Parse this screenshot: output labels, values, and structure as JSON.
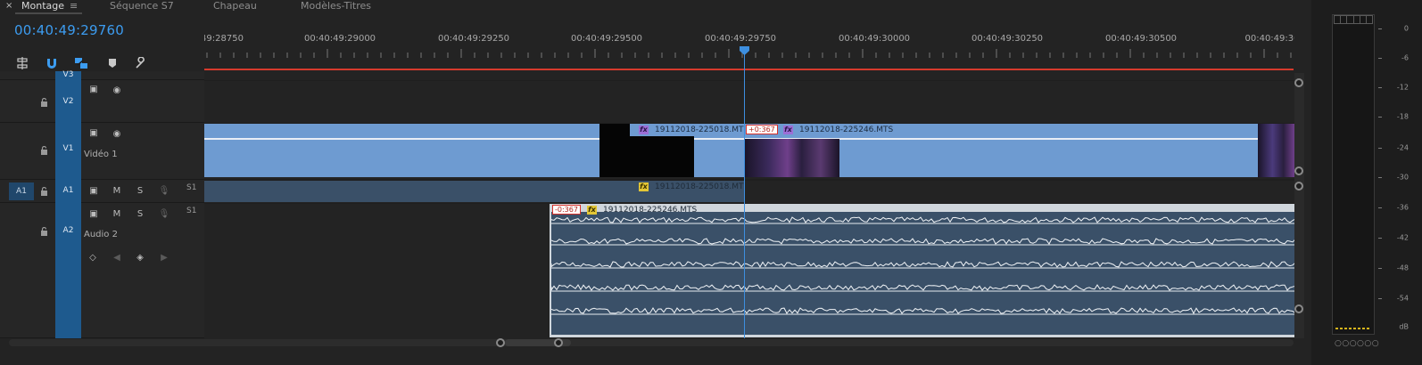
{
  "tabs": {
    "close_glyph": "×",
    "menu_glyph": "≡",
    "items": [
      {
        "label": "Montage",
        "active": true
      },
      {
        "label": "Séquence S7",
        "active": false
      },
      {
        "label": "Chapeau",
        "active": false
      },
      {
        "label": "Modèles-Titres",
        "active": false
      }
    ]
  },
  "timecode": "00:40:49:29760",
  "toolbar": [
    "insert-nest-icon",
    "snap-magnet-icon",
    "linked-selection-icon",
    "add-marker-icon",
    "settings-wrench-icon"
  ],
  "ruler": {
    "labels": [
      "49:28750",
      "00:40:49:29000",
      "00:40:49:29250",
      "00:40:49:29500",
      "00:40:49:29750",
      "00:40:49:30000",
      "00:40:49:30250",
      "00:40:49:30500",
      "00:40:49:30"
    ]
  },
  "tracks": {
    "v3": {
      "target": "V3"
    },
    "v2": {
      "target": "V2"
    },
    "v1": {
      "target": "V1",
      "name": "Vidéo 1"
    },
    "a1": {
      "source": "A1",
      "target": "A1",
      "mute": "M",
      "solo": "S",
      "sync": "S1"
    },
    "a2": {
      "target": "A2",
      "name": "Audio 2",
      "mute": "M",
      "solo": "S",
      "sync": "S1"
    }
  },
  "clips": {
    "v1_a": {
      "name": "19112018-225018.MTS [V]",
      "fx": "fx"
    },
    "v1_b": {
      "name": "19112018-225246.MTS",
      "fx": "fx",
      "offset": "+0:367"
    },
    "a1_a": {
      "name": "19112018-225018.MTS [A]",
      "fx": "fx"
    },
    "a2_b": {
      "name": "19112018-225246.MTS",
      "fx": "fx",
      "offset": "-0:367"
    }
  },
  "meter": {
    "db_labels": [
      "0",
      "-6",
      "-12",
      "-18",
      "-24",
      "-30",
      "-36",
      "-42",
      "-48",
      "-54",
      "dB"
    ],
    "solo_dots": "○○○○○○"
  },
  "colors": {
    "accent": "#3c9cf0",
    "video_clip": "#6e9bd1",
    "audio_clip": "#3a5068",
    "target_track": "#1e5a8e",
    "sync_offset": "#d8312a",
    "playhead": "#3d8fe0",
    "fx_video": "#9c6fd6",
    "fx_audio": "#e3c636"
  }
}
